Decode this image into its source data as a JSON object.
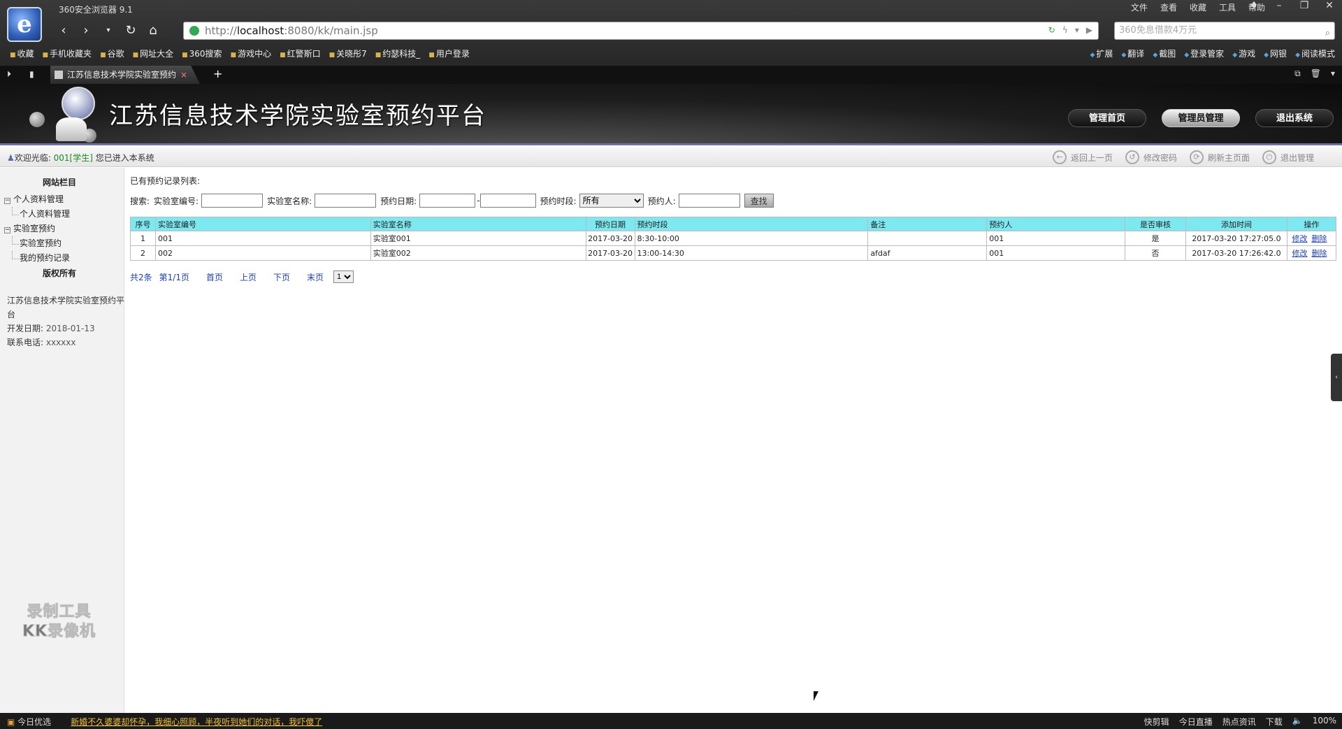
{
  "browser": {
    "app_title": "360安全浏览器 9.1",
    "menu": [
      "文件",
      "查看",
      "收藏",
      "工具",
      "帮助"
    ],
    "url_prefix": "http://",
    "url_host": "localhost",
    "url_rest": ":8080/kk/main.jsp",
    "search_placeholder": "360免息借款4万元",
    "bookmarks": [
      "收藏",
      "手机收藏夹",
      "谷歌",
      "网址大全",
      "360搜索",
      "游戏中心",
      "红警斯口",
      "关晓彤7",
      "约瑟科技_",
      "用户登录"
    ],
    "bookmarks_right": [
      "扩展",
      "翻译",
      "截图",
      "登录管家",
      "游戏",
      "网银",
      "阅读模式"
    ],
    "tab_title": "江苏信息技术学院实验室预约"
  },
  "header": {
    "site_title": "江苏信息技术学院实验室预约平台",
    "nav": [
      "管理首页",
      "管理员管理",
      "退出系统"
    ]
  },
  "welcome": {
    "prefix": "欢迎光临:",
    "user": "001[学生]",
    "suffix": "您已进入本系统"
  },
  "quick_actions": [
    "返回上一页",
    "修改密码",
    "刷新主页面",
    "退出管理"
  ],
  "sidebar": {
    "title": "网站栏目",
    "groups": [
      {
        "label": "个人资料管理",
        "children": [
          "个人资料管理"
        ]
      },
      {
        "label": "实验室预约",
        "children": [
          "实验室预约",
          "我的预约记录"
        ]
      }
    ],
    "copyright": "版权所有",
    "info_name": "江苏信息技术学院实验室预约平台",
    "dev_date_label": "开发日期:",
    "dev_date": "2018-01-13",
    "phone_label": "联系电话:",
    "phone": "xxxxxx",
    "watermark_line1": "录制工具",
    "watermark_line2": "KK录像机"
  },
  "main": {
    "list_title": "已有预约记录列表:",
    "search": {
      "label": "搜索:",
      "lab_no_label": "实验室编号:",
      "lab_name_label": "实验室名称:",
      "date_label": "预约日期:",
      "date_sep": "-",
      "period_label": "预约时段:",
      "period_value": "所有",
      "person_label": "预约人:",
      "button": "查找"
    },
    "columns": [
      "序号",
      "实验室编号",
      "实验室名称",
      "预约日期",
      "预约时段",
      "备注",
      "预约人",
      "是否审核",
      "添加时间",
      "操作"
    ],
    "rows": [
      {
        "no": "1",
        "lab_no": "001",
        "lab_name": "实验室001",
        "date": "2017-03-20",
        "period": "8:30-10:00",
        "note": "",
        "person": "001",
        "audited": "是",
        "added": "2017-03-20 17:27:05.0",
        "edit": "修改",
        "delete": "删除"
      },
      {
        "no": "2",
        "lab_no": "002",
        "lab_name": "实验室002",
        "date": "2017-03-20",
        "period": "13:00-14:30",
        "note": "afdaf",
        "person": "001",
        "audited": "否",
        "added": "2017-03-20 17:26:42.0",
        "edit": "修改",
        "delete": "删除"
      }
    ],
    "pager": {
      "total": "共2条",
      "page": "第1/1页",
      "first": "首页",
      "prev": "上页",
      "next": "下页",
      "last": "末页",
      "select_value": "1"
    }
  },
  "statusbar": {
    "left_label": "今日优选",
    "news": "新婚不久婆婆却怀孕，我细心照顾，半夜听到她们的对话，我吓傻了",
    "right": [
      "快剪辑",
      "今日直播",
      "热点资讯",
      "下载",
      "100%"
    ]
  }
}
